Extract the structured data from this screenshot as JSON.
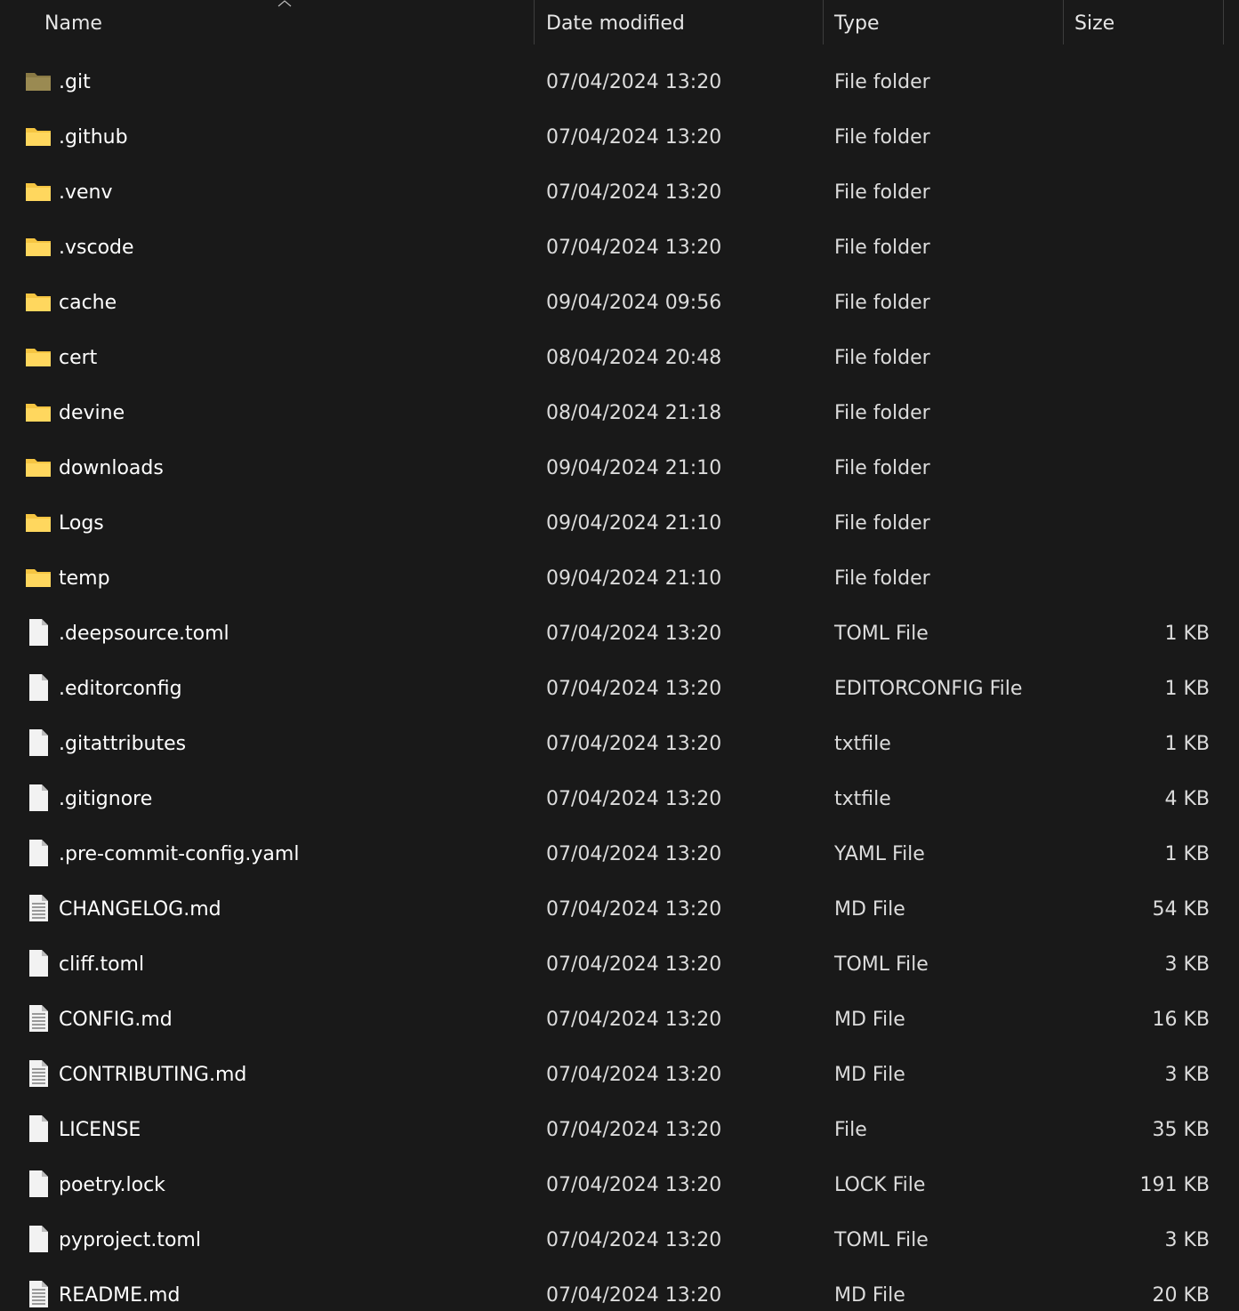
{
  "columns": {
    "name": "Name",
    "date": "Date modified",
    "type": "Type",
    "size": "Size"
  },
  "rows": [
    {
      "name": ".git",
      "date": "07/04/2024 13:20",
      "type": "File folder",
      "size": "",
      "icon": "folder-dimmed-icon"
    },
    {
      "name": ".github",
      "date": "07/04/2024 13:20",
      "type": "File folder",
      "size": "",
      "icon": "folder-icon"
    },
    {
      "name": ".venv",
      "date": "07/04/2024 13:20",
      "type": "File folder",
      "size": "",
      "icon": "folder-icon"
    },
    {
      "name": ".vscode",
      "date": "07/04/2024 13:20",
      "type": "File folder",
      "size": "",
      "icon": "folder-icon"
    },
    {
      "name": "cache",
      "date": "09/04/2024 09:56",
      "type": "File folder",
      "size": "",
      "icon": "folder-icon"
    },
    {
      "name": "cert",
      "date": "08/04/2024 20:48",
      "type": "File folder",
      "size": "",
      "icon": "folder-icon"
    },
    {
      "name": "devine",
      "date": "08/04/2024 21:18",
      "type": "File folder",
      "size": "",
      "icon": "folder-icon"
    },
    {
      "name": "downloads",
      "date": "09/04/2024 21:10",
      "type": "File folder",
      "size": "",
      "icon": "folder-icon"
    },
    {
      "name": "Logs",
      "date": "09/04/2024 21:10",
      "type": "File folder",
      "size": "",
      "icon": "folder-icon"
    },
    {
      "name": "temp",
      "date": "09/04/2024 21:10",
      "type": "File folder",
      "size": "",
      "icon": "folder-icon"
    },
    {
      "name": ".deepsource.toml",
      "date": "07/04/2024 13:20",
      "type": "TOML File",
      "size": "1 KB",
      "icon": "file-icon"
    },
    {
      "name": ".editorconfig",
      "date": "07/04/2024 13:20",
      "type": "EDITORCONFIG File",
      "size": "1 KB",
      "icon": "file-icon"
    },
    {
      "name": ".gitattributes",
      "date": "07/04/2024 13:20",
      "type": "txtfile",
      "size": "1 KB",
      "icon": "file-icon"
    },
    {
      "name": ".gitignore",
      "date": "07/04/2024 13:20",
      "type": "txtfile",
      "size": "4 KB",
      "icon": "file-icon"
    },
    {
      "name": ".pre-commit-config.yaml",
      "date": "07/04/2024 13:20",
      "type": "YAML File",
      "size": "1 KB",
      "icon": "file-icon"
    },
    {
      "name": "CHANGELOG.md",
      "date": "07/04/2024 13:20",
      "type": "MD File",
      "size": "54 KB",
      "icon": "text-file-icon"
    },
    {
      "name": "cliff.toml",
      "date": "07/04/2024 13:20",
      "type": "TOML File",
      "size": "3 KB",
      "icon": "file-icon"
    },
    {
      "name": "CONFIG.md",
      "date": "07/04/2024 13:20",
      "type": "MD File",
      "size": "16 KB",
      "icon": "text-file-icon"
    },
    {
      "name": "CONTRIBUTING.md",
      "date": "07/04/2024 13:20",
      "type": "MD File",
      "size": "3 KB",
      "icon": "text-file-icon"
    },
    {
      "name": "LICENSE",
      "date": "07/04/2024 13:20",
      "type": "File",
      "size": "35 KB",
      "icon": "file-icon"
    },
    {
      "name": "poetry.lock",
      "date": "07/04/2024 13:20",
      "type": "LOCK File",
      "size": "191 KB",
      "icon": "file-icon"
    },
    {
      "name": "pyproject.toml",
      "date": "07/04/2024 13:20",
      "type": "TOML File",
      "size": "3 KB",
      "icon": "file-icon"
    },
    {
      "name": "README.md",
      "date": "07/04/2024 13:20",
      "type": "MD File",
      "size": "20 KB",
      "icon": "text-file-icon"
    }
  ],
  "colors": {
    "background": "#191919",
    "folder": "#f5c542",
    "folder_dimmed": "#8a7a45",
    "file": "#f2f2f2"
  }
}
